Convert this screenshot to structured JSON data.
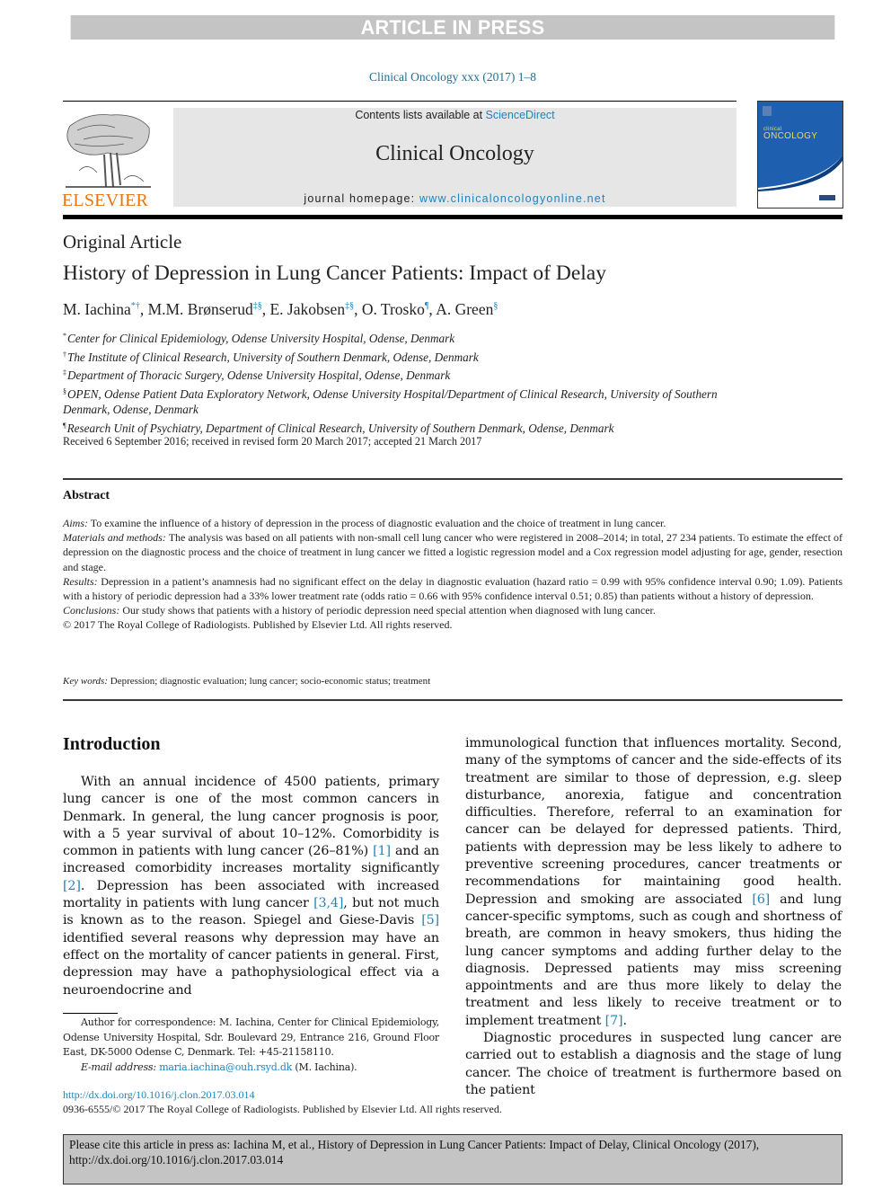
{
  "banner": {
    "label": "ARTICLE IN PRESS"
  },
  "journal_ref": "Clinical Oncology xxx (2017) 1–8",
  "header": {
    "publisher_logo_text": "ELSEVIER",
    "contents_prefix": "Contents lists available at ",
    "contents_link": "ScienceDirect",
    "journal_name": "Clinical Oncology",
    "homepage_prefix": "journal homepage: ",
    "homepage_link": "www.clinicaloncologyonline.net",
    "cover_small": "clinical",
    "cover_big": "ONCOLOGY"
  },
  "article": {
    "type": "Original Article",
    "title": "History of Depression in Lung Cancer Patients: Impact of Delay",
    "authors": [
      {
        "name": "M. Iachina",
        "marks": "*†",
        "sep": ", "
      },
      {
        "name": "M.M. Brønserud",
        "marks": "‡§",
        "sep": ", "
      },
      {
        "name": "E. Jakobsen",
        "marks": "‡§",
        "sep": ", "
      },
      {
        "name": "O. Trosko",
        "marks": "¶",
        "sep": ", "
      },
      {
        "name": "A. Green",
        "marks": "§",
        "sep": ""
      }
    ],
    "affiliations": [
      {
        "mark": "*",
        "text": "Center for Clinical Epidemiology, Odense University Hospital, Odense, Denmark"
      },
      {
        "mark": "†",
        "text": "The Institute of Clinical Research, University of Southern Denmark, Odense, Denmark"
      },
      {
        "mark": "‡",
        "text": "Department of Thoracic Surgery, Odense University Hospital, Odense, Denmark"
      },
      {
        "mark": "§",
        "text": "OPEN, Odense Patient Data Exploratory Network, Odense University Hospital/Department of Clinical Research, University of Southern Denmark, Odense, Denmark"
      },
      {
        "mark": "¶",
        "text": "Research Unit of Psychiatry, Department of Clinical Research, University of Southern Denmark, Odense, Denmark"
      }
    ],
    "received": "Received 6 September 2016; received in revised form 20 March 2017; accepted 21 March 2017"
  },
  "abstract": {
    "heading": "Abstract",
    "sections": [
      {
        "label": "Aims:",
        "text": " To examine the influence of a history of depression in the process of diagnostic evaluation and the choice of treatment in lung cancer."
      },
      {
        "label": "Materials and methods:",
        "text": " The analysis was based on all patients with non-small cell lung cancer who were registered in 2008–2014; in total, 27 234 patients. To estimate the effect of depression on the diagnostic process and the choice of treatment in lung cancer we fitted a logistic regression model and a Cox regression model adjusting for age, gender, resection and stage."
      },
      {
        "label": "Results:",
        "text": " Depression in a patient’s anamnesis had no significant effect on the delay in diagnostic evaluation (hazard ratio = 0.99 with 95% confidence interval 0.90; 1.09). Patients with a history of periodic depression had a 33% lower treatment rate (odds ratio = 0.66 with 95% confidence interval 0.51; 0.85) than patients without a history of depression."
      },
      {
        "label": "Conclusions:",
        "text": " Our study shows that patients with a history of periodic depression need special attention when diagnosed with lung cancer."
      }
    ],
    "copyright": "© 2017 The Royal College of Radiologists. Published by Elsevier Ltd. All rights reserved."
  },
  "keywords": {
    "label": "Key words:",
    "text": " Depression; diagnostic evaluation; lung cancer; socio-economic status; treatment"
  },
  "introduction": {
    "heading": "Introduction",
    "left_col": [
      {
        "t": "With an annual incidence of 4500 patients, primary lung cancer is one of the most common cancers in Denmark. In general, the lung cancer prognosis is poor, with a 5 year survival of about 10–12%. Comorbidity is common in patients with lung cancer (26–81%) "
      },
      {
        "ref": "[1]"
      },
      {
        "t": " and an increased comorbidity increases mortality significantly "
      },
      {
        "ref": "[2]"
      },
      {
        "t": ". Depression has been associated with increased mortality in patients with lung cancer "
      },
      {
        "ref": "[3,4]"
      },
      {
        "t": ", but not much is known as to the reason. Spiegel and Giese-Davis "
      },
      {
        "ref": "[5]"
      },
      {
        "t": " identified several reasons why depression may have an effect on the mortality of cancer patients in general. First, depression may have a pathophysiological effect via a neuroendocrine and"
      }
    ],
    "right_col_p1": [
      {
        "t": "immunological function that influences mortality. Second, many of the symptoms of cancer and the side-effects of its treatment are similar to those of depression, e.g. sleep disturbance, anorexia, fatigue and concentration difficulties. Therefore, referral to an examination for cancer can be delayed for depressed patients. Third, patients with depression may be less likely to adhere to preventive screening procedures, cancer treatments or recommendations for maintaining good health. Depression and smoking are associated "
      },
      {
        "ref": "[6]"
      },
      {
        "t": " and lung cancer-specific symptoms, such as cough and shortness of breath, are common in heavy smokers, thus hiding the lung cancer symptoms and adding further delay to the diagnosis. Depressed patients may miss screening appointments and are thus more likely to delay the treatment and less likely to receive treatment or to implement treatment "
      },
      {
        "ref": "[7]"
      },
      {
        "t": "."
      }
    ],
    "right_col_p2": "Diagnostic procedures in suspected lung cancer are carried out to establish a diagnosis and the stage of lung cancer. The choice of treatment is furthermore based on the patient"
  },
  "footnote": {
    "correspondence": "Author for correspondence: M. Iachina, Center for Clinical Epidemiology, Odense University Hospital, Sdr. Boulevard 29, Entrance 216, Ground Floor East, DK-5000 Odense C, Denmark. Tel: +45-21158110.",
    "email_label": "E-mail address:",
    "email": "maria.iachina@ouh.rsyd.dk",
    "email_suffix": " (M. Iachina)."
  },
  "footer": {
    "doi": "http://dx.doi.org/10.1016/j.clon.2017.03.014",
    "issn": "0936-6555/© 2017 The Royal College of Radiologists. Published by Elsevier Ltd. All rights reserved.",
    "cite": "Please cite this article in press as: Iachina M, et al., History of Depression in Lung Cancer Patients: Impact of Delay, Clinical Oncology (2017), http://dx.doi.org/10.1016/j.clon.2017.03.014"
  }
}
